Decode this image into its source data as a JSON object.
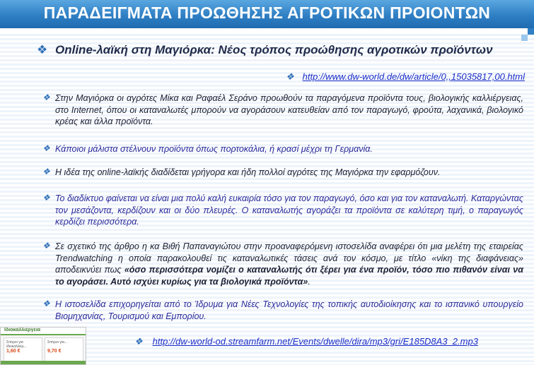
{
  "title": "ΠΑΡΑΔΕΙΓΜΑΤΑ ΠΡΟΩΘΗΣΗΣ ΑΓΡΟΤΙΚΩΝ ΠΡΟΙΟΝΤΩΝ",
  "bullet_symbol": "❖",
  "subtitle": "Online-λαϊκή στη Μαγιόρκα: Νέος τρόπος προώθησης αγροτικών προϊόντων",
  "link_article": "http://www.dw-world.de/dw/article/0,,15035817,00.html",
  "paragraphs": [
    "Στην Μαγιόρκα οι αγρότες Μίκα και Ραφαέλ Σεράνο προωθούν τα παραγόμενα προϊόντα τους, βιολογικής καλλιέργειας, στο Internet, όπου οι καταναλωτές μπορούν να αγοράσουν κατευθείαν από τον παραγωγό, φρούτα, λαχανικά, βιολογικό κρέας και άλλα προϊόντα.",
    "Κάποιοι μάλιστα στέλνουν προϊόντα όπως πορτοκάλια, ή κρασί μέχρι τη Γερμανία.",
    "Η ιδέα της online-λαϊκής διαδίδεται γρήγορα και ήδη πολλοί αγρότες της Μαγιόρκα την εφαρμόζουν.",
    "Το διαδίκτυο φαίνεται να είναι μια πολύ καλή ευκαιρία τόσο για τον παραγωγό, όσο και για τον καταναλωτή. Καταργώντας τον μεσάζοντα, κερδίζουν και οι δύο πλευρές. Ο καταναλωτής αγοράζει τα προϊόντα σε καλύτερη τιμή, ο παραγωγός κερδίζει περισσότερα.",
    "Η ιστοσελίδα επιχορηγείται από το Ίδρυμα για Νέες Τεχνολογίες της τοπικής αυτοδιοίκησης και το ισπανικό υπουργείο Βιομηχανίας, Τουρισμού και Εμπορίου."
  ],
  "article_paragraph": {
    "intro": "Σε σχετικό της άρθρο η κα Βιθή Παπαναγιώτου στην προαναφερόμενη ιστοσελίδα αναφέρει ότι μια μελέτη της εταιρείας Trendwatching η οποία παρακολουθεί τις καταναλωτικές τάσεις ανά τον κόσμο, με τίτλο «νίκη της διαφάνειας» αποδεικνύει πως ",
    "quote": "«όσο περισσότερα νομίζει ο καταναλωτής ότι ξέρει για ένα προϊόν, τόσο πιο πιθανόν είναι να το αγοράσει. Αυτό ισχύει κυρίως για τα βιολογικά προϊόντα»",
    "end": "."
  },
  "link_audio": "http://dw-world-od.streamfarm.net/Events/dwelle/dira/mp3/gri/E185D8A3_2.mp3",
  "thumbnail": {
    "site_name": "Ιδιοκαλλιέργεια",
    "price_1": "1,60 €",
    "price_2": "9,70 €",
    "caption_1": "Σπόροι για ιδιοκαλλιέρ...",
    "caption_2": "Σπόροι για..."
  },
  "colors": {
    "title_bar": "#2f7fc4",
    "bullet": "#2e6fb8",
    "link": "#1a2dc8",
    "body_text_dark": "#1b1f33",
    "body_text_blue": "#2b2a9a"
  }
}
